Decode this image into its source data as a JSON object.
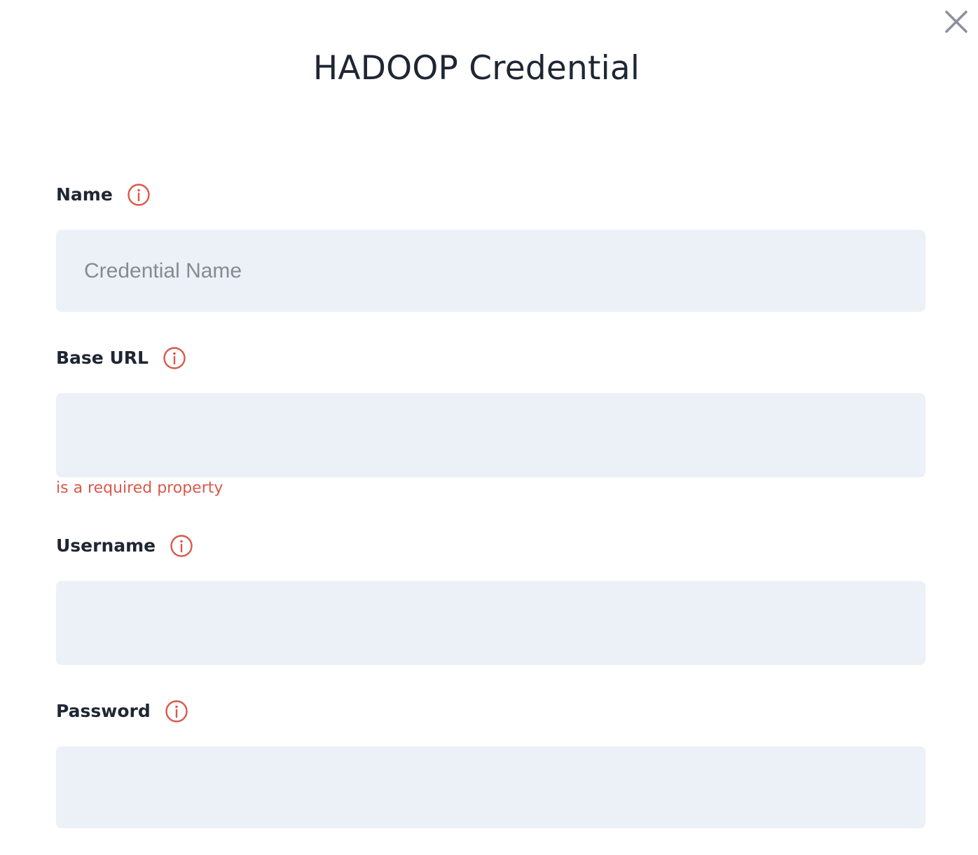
{
  "dialog": {
    "title": "HADOOP Credential",
    "close_icon": "close-icon"
  },
  "colors": {
    "accent_error": "#d9594c",
    "input_bg": "#ecf0f7",
    "text": "#1f2633",
    "close_icon": "#8a909c"
  },
  "fields": {
    "name": {
      "label": "Name",
      "placeholder": "Credential Name",
      "value": "",
      "icon": "info-icon"
    },
    "base_url": {
      "label": "Base URL",
      "placeholder": "",
      "value": "",
      "error": "is a required property",
      "icon": "info-icon"
    },
    "username": {
      "label": "Username",
      "placeholder": "",
      "value": "",
      "icon": "info-icon"
    },
    "password": {
      "label": "Password",
      "placeholder": "",
      "value": "",
      "icon": "info-icon"
    }
  }
}
